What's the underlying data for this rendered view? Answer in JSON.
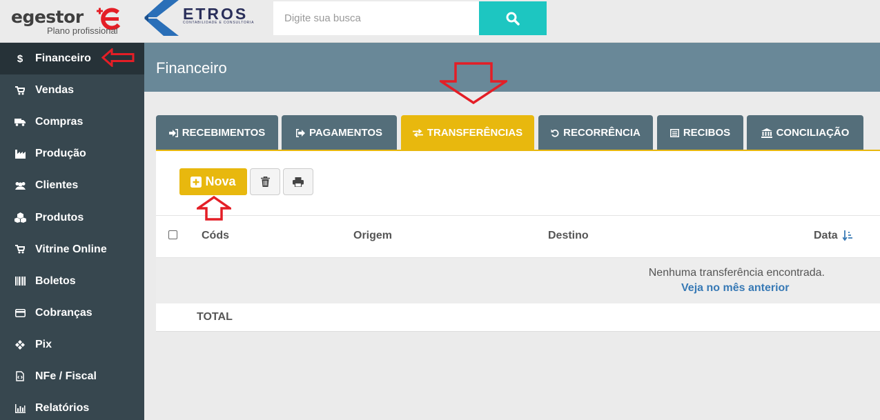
{
  "brand": {
    "name": "egestor",
    "plan": "Plano profissional"
  },
  "partner": {
    "name": "ETROS",
    "tagline": "CONTABILIDADE E CONSULTORIA"
  },
  "search": {
    "placeholder": "Digite sua busca"
  },
  "colors": {
    "accent": "#e8b80e",
    "sidebar": "#37474f",
    "header": "#698898",
    "tab": "#546e7a",
    "search_button": "#1dc6c1",
    "link": "#3779b5",
    "annotation": "#e41e26"
  },
  "sidebar": {
    "items": [
      {
        "label": "Financeiro",
        "icon": "dollar-icon",
        "active": true
      },
      {
        "label": "Vendas",
        "icon": "cart-icon"
      },
      {
        "label": "Compras",
        "icon": "truck-icon"
      },
      {
        "label": "Produção",
        "icon": "factory-icon"
      },
      {
        "label": "Clientes",
        "icon": "users-icon"
      },
      {
        "label": "Produtos",
        "icon": "cubes-icon"
      },
      {
        "label": "Vitrine Online",
        "icon": "cart-icon"
      },
      {
        "label": "Boletos",
        "icon": "barcode-icon"
      },
      {
        "label": "Cobranças",
        "icon": "credit-card-icon"
      },
      {
        "label": "Pix",
        "icon": "pix-icon"
      },
      {
        "label": "NFe / Fiscal",
        "icon": "file-code-icon"
      },
      {
        "label": "Relatórios",
        "icon": "bar-chart-icon"
      }
    ]
  },
  "header": {
    "title": "Financeiro"
  },
  "tabs": [
    {
      "label": "RECEBIMENTOS",
      "icon": "sign-in-icon"
    },
    {
      "label": "PAGAMENTOS",
      "icon": "sign-out-icon"
    },
    {
      "label": "TRANSFERÊNCIAS",
      "icon": "exchange-icon",
      "active": true
    },
    {
      "label": "RECORRÊNCIA",
      "icon": "undo-icon"
    },
    {
      "label": "RECIBOS",
      "icon": "list-alt-icon"
    },
    {
      "label": "CONCILIAÇÃO",
      "icon": "bank-icon"
    }
  ],
  "toolbar": {
    "new_label": "Nova"
  },
  "table": {
    "columns": {
      "code": "Códs",
      "origin": "Origem",
      "destination": "Destino",
      "date": "Data"
    },
    "empty_message": "Nenhuma transferência encontrada.",
    "empty_link": "Veja no mês anterior",
    "total_label": "TOTAL"
  }
}
